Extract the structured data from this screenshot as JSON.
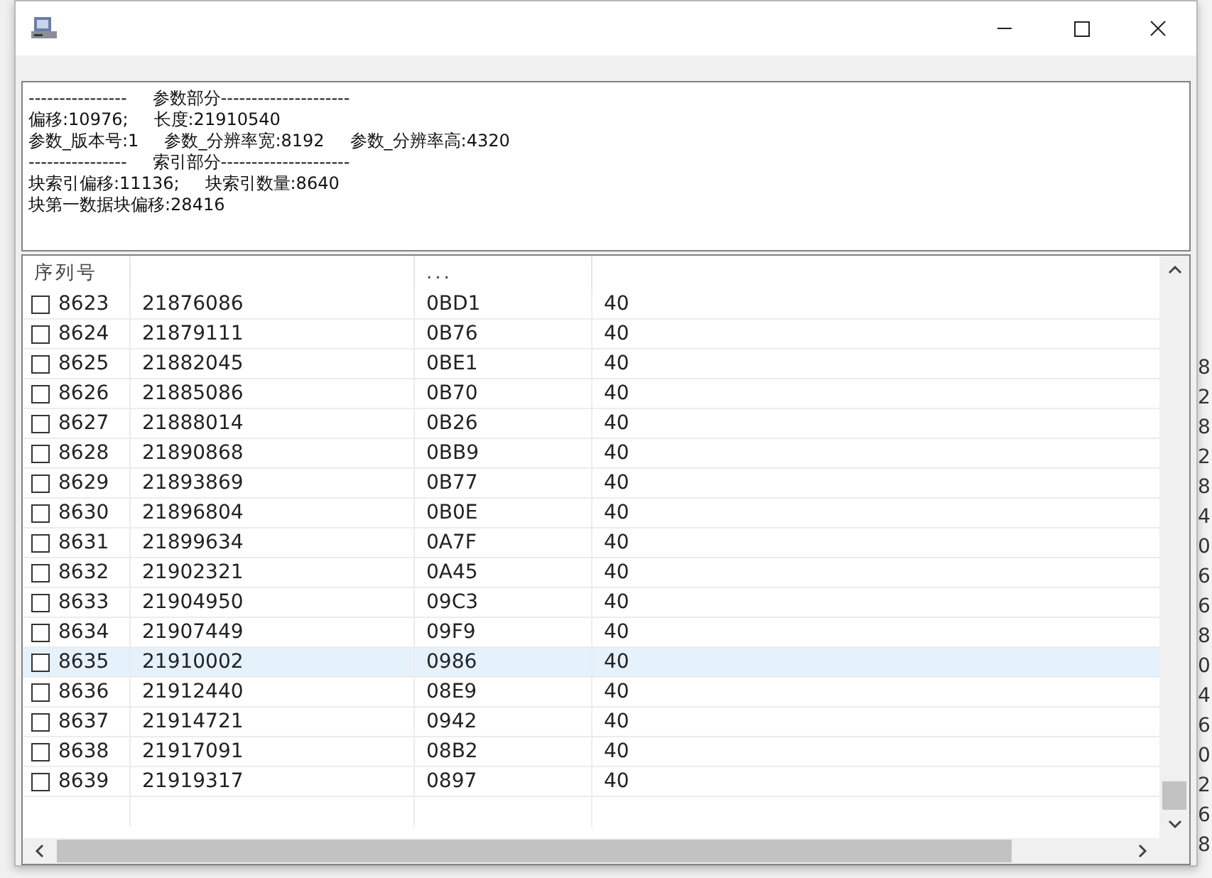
{
  "window": {
    "controls": [
      {
        "kind": "minimize"
      },
      {
        "kind": "maximize"
      },
      {
        "kind": "close"
      }
    ]
  },
  "info_lines": [
    [
      "----------------",
      "参数部分---------------------"
    ],
    [
      "偏移:10976;",
      "长度:21910540"
    ],
    [
      "参数_版本号:1",
      "参数_分辨率宽:8192",
      "参数_分辨率高:4320"
    ],
    [
      "----------------",
      "索引部分---------------------"
    ],
    [
      "块索引偏移:11136;",
      "块索引数量:8640"
    ],
    [
      "块第一数据块偏移:28416"
    ]
  ],
  "table": {
    "columns": [
      {
        "label": "序列号"
      },
      {},
      {
        "label": "..."
      },
      {}
    ],
    "rows": [
      {
        "checked": false,
        "selected": false,
        "cells": [
          "8623",
          "21876086",
          "0BD1",
          "40"
        ]
      },
      {
        "checked": false,
        "selected": false,
        "cells": [
          "8624",
          "21879111",
          "0B76",
          "40"
        ]
      },
      {
        "checked": false,
        "selected": false,
        "cells": [
          "8625",
          "21882045",
          "0BE1",
          "40"
        ]
      },
      {
        "checked": false,
        "selected": false,
        "cells": [
          "8626",
          "21885086",
          "0B70",
          "40"
        ]
      },
      {
        "checked": false,
        "selected": false,
        "cells": [
          "8627",
          "21888014",
          "0B26",
          "40"
        ]
      },
      {
        "checked": false,
        "selected": false,
        "cells": [
          "8628",
          "21890868",
          "0BB9",
          "40"
        ]
      },
      {
        "checked": false,
        "selected": false,
        "cells": [
          "8629",
          "21893869",
          "0B77",
          "40"
        ]
      },
      {
        "checked": false,
        "selected": false,
        "cells": [
          "8630",
          "21896804",
          "0B0E",
          "40"
        ]
      },
      {
        "checked": false,
        "selected": false,
        "cells": [
          "8631",
          "21899634",
          "0A7F",
          "40"
        ]
      },
      {
        "checked": false,
        "selected": false,
        "cells": [
          "8632",
          "21902321",
          "0A45",
          "40"
        ]
      },
      {
        "checked": false,
        "selected": false,
        "cells": [
          "8633",
          "21904950",
          "09C3",
          "40"
        ]
      },
      {
        "checked": false,
        "selected": false,
        "cells": [
          "8634",
          "21907449",
          "09F9",
          "40"
        ]
      },
      {
        "checked": false,
        "selected": true,
        "cells": [
          "8635",
          "21910002",
          "0986",
          "40"
        ]
      },
      {
        "checked": false,
        "selected": false,
        "cells": [
          "8636",
          "21912440",
          "08E9",
          "40"
        ]
      },
      {
        "checked": false,
        "selected": false,
        "cells": [
          "8637",
          "21914721",
          "0942",
          "40"
        ]
      },
      {
        "checked": false,
        "selected": false,
        "cells": [
          "8638",
          "21917091",
          "08B2",
          "40"
        ]
      },
      {
        "checked": false,
        "selected": false,
        "cells": [
          "8639",
          "21919317",
          "0897",
          "40"
        ]
      }
    ]
  },
  "background_column": [
    "8",
    "2",
    "8",
    "2",
    "8",
    "4",
    "0",
    "6",
    "6",
    "8",
    "0",
    "4",
    "6",
    "0",
    "2",
    "6",
    "8"
  ]
}
